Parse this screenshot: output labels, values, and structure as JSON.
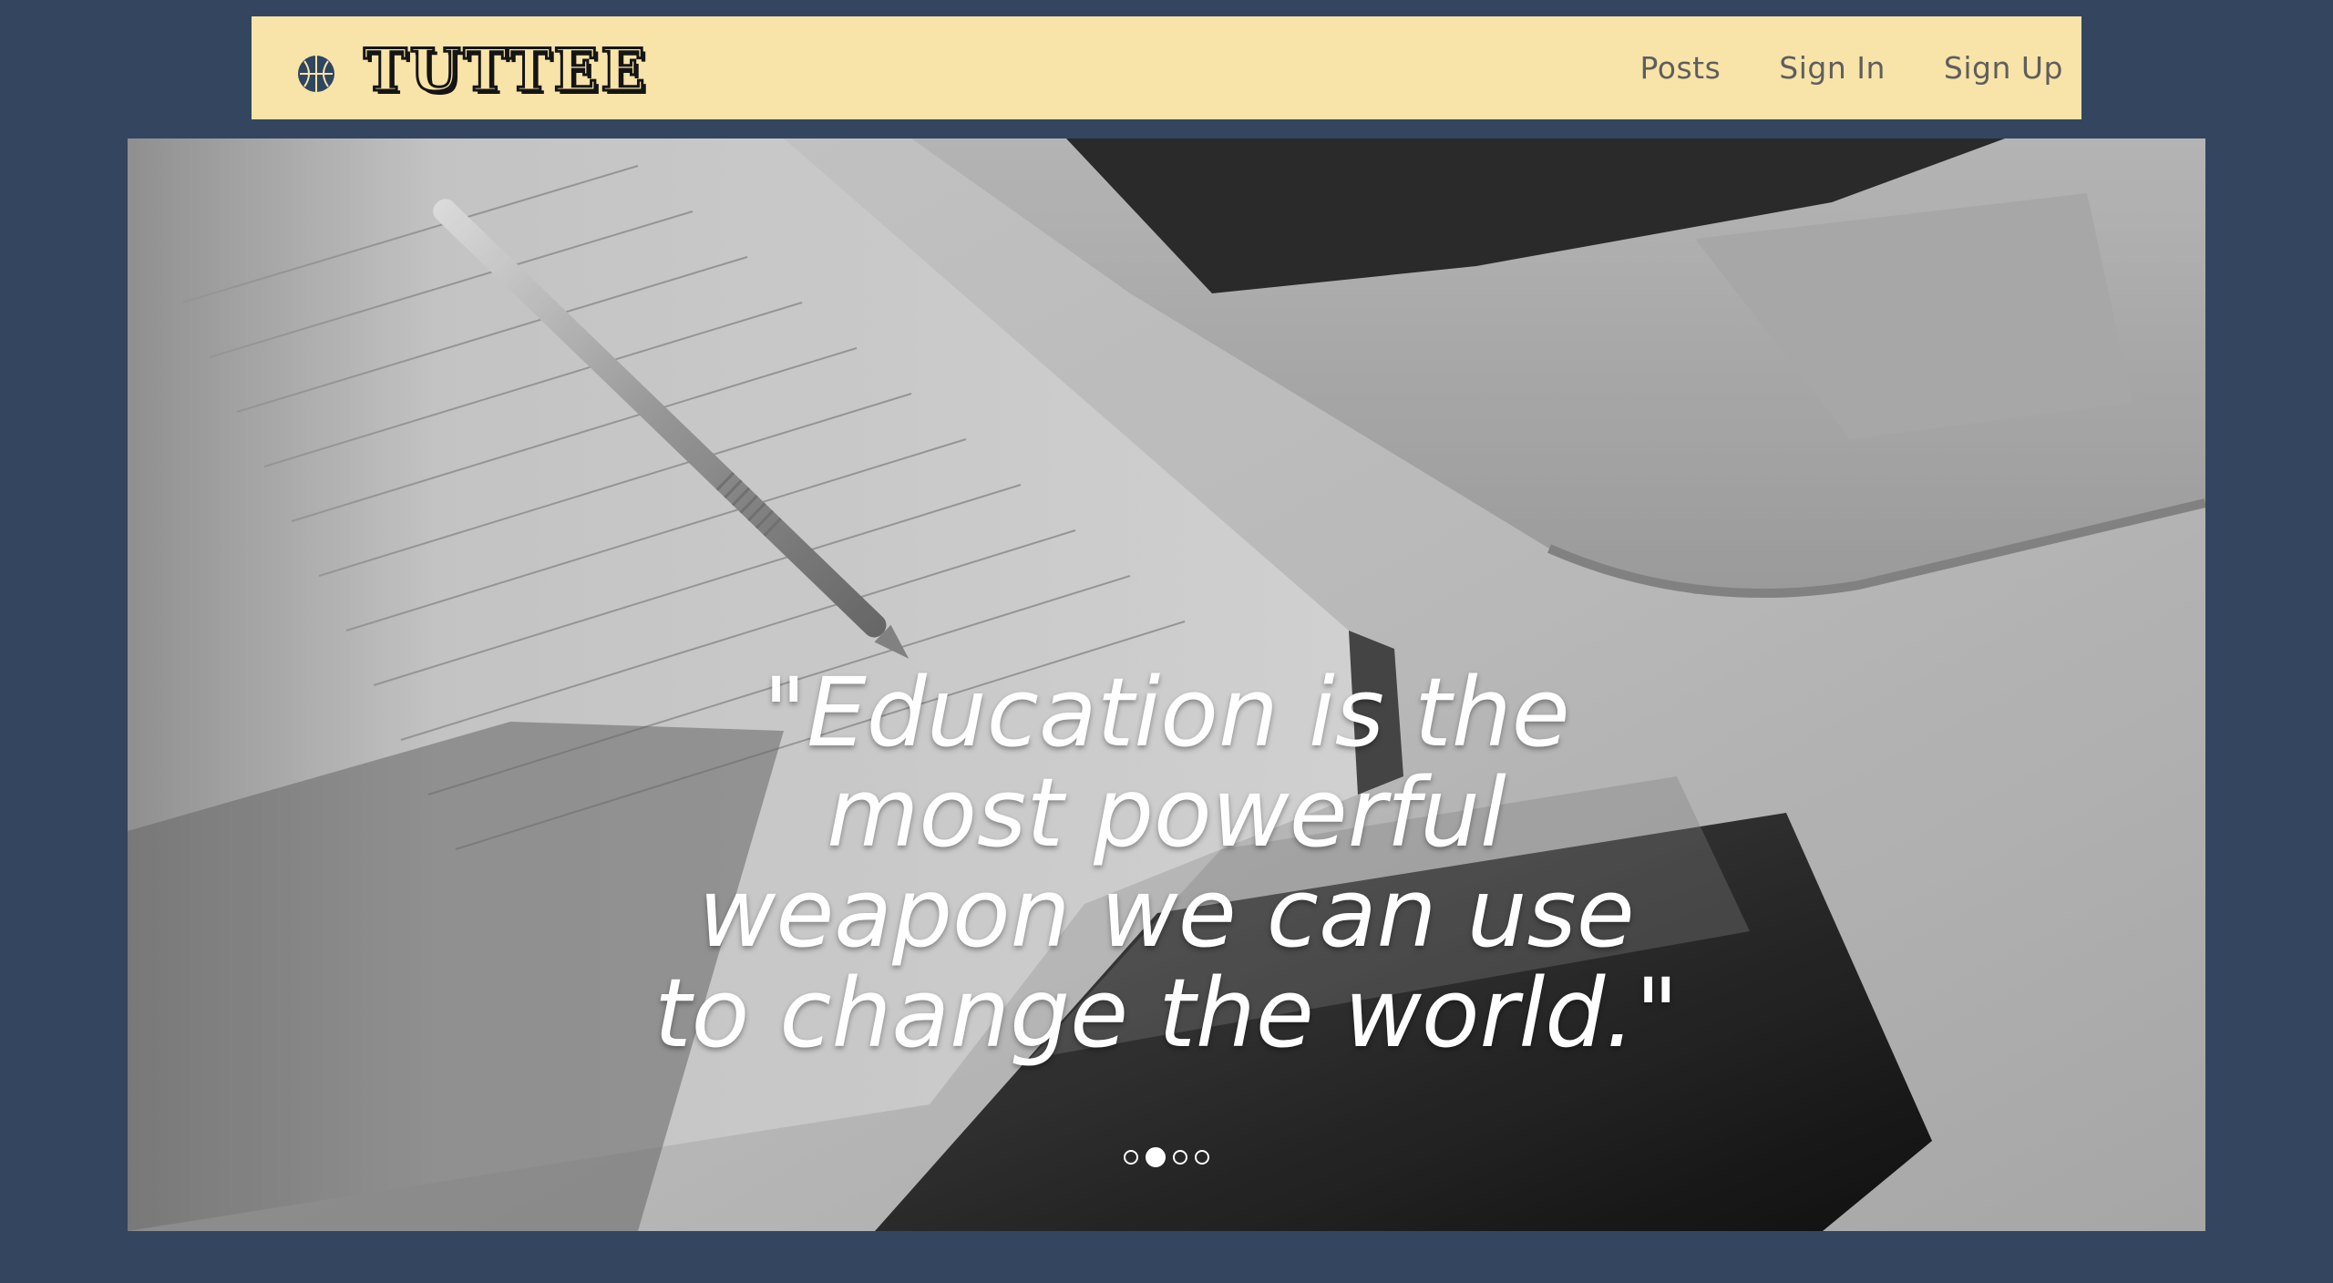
{
  "brand": {
    "name": "TUTTEE",
    "icon": "basketball-icon",
    "accent_color": "#2f4560"
  },
  "nav": {
    "links": [
      {
        "label": "Posts"
      },
      {
        "label": "Sign In"
      },
      {
        "label": "Sign Up"
      }
    ]
  },
  "hero": {
    "quote_lines": [
      "\"Education is the",
      "most powerful",
      "weapon we can use",
      "to change the world.\""
    ],
    "background": "grayscale photo of an open notebook with a pen, a laptop and a smartphone",
    "carousel": {
      "slide_count": 4,
      "active_index": 1
    }
  },
  "colors": {
    "page_background": "#34465f",
    "navbar_background": "#f8e4a8",
    "nav_text": "#5e5e5e",
    "quote_text": "#ffffff"
  }
}
